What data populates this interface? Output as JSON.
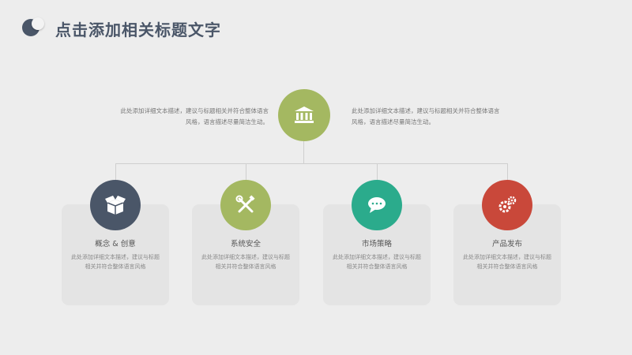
{
  "header": {
    "title": "点击添加相关标题文字"
  },
  "top": {
    "left_text": "此处添加详细文本描述，建议与标题相关并符合整体语言风格，语言描述尽量简洁生动。",
    "right_text": "此处添加详细文本描述，建议与标题相关并符合整体语言风格，语言描述尽量简洁生动。",
    "hub_icon": "bank-icon",
    "hub_color": "#a4b861"
  },
  "cards": [
    {
      "title": "概念 & 创意",
      "desc": "此处添加详细文本描述，建议与标题相关并符合整体语言风格",
      "icon": "box-icon",
      "color": "#4a5668"
    },
    {
      "title": "系统安全",
      "desc": "此处添加详细文本描述，建议与标题相关并符合整体语言风格",
      "icon": "tools-icon",
      "color": "#a4b861"
    },
    {
      "title": "市场策略",
      "desc": "此处添加详细文本描述，建议与标题相关并符合整体语言风格",
      "icon": "chat-icon",
      "color": "#2bab8c"
    },
    {
      "title": "产品发布",
      "desc": "此处添加详细文本描述，建议与标题相关并符合整体语言风格",
      "icon": "gear-icon",
      "color": "#c9483a"
    }
  ]
}
